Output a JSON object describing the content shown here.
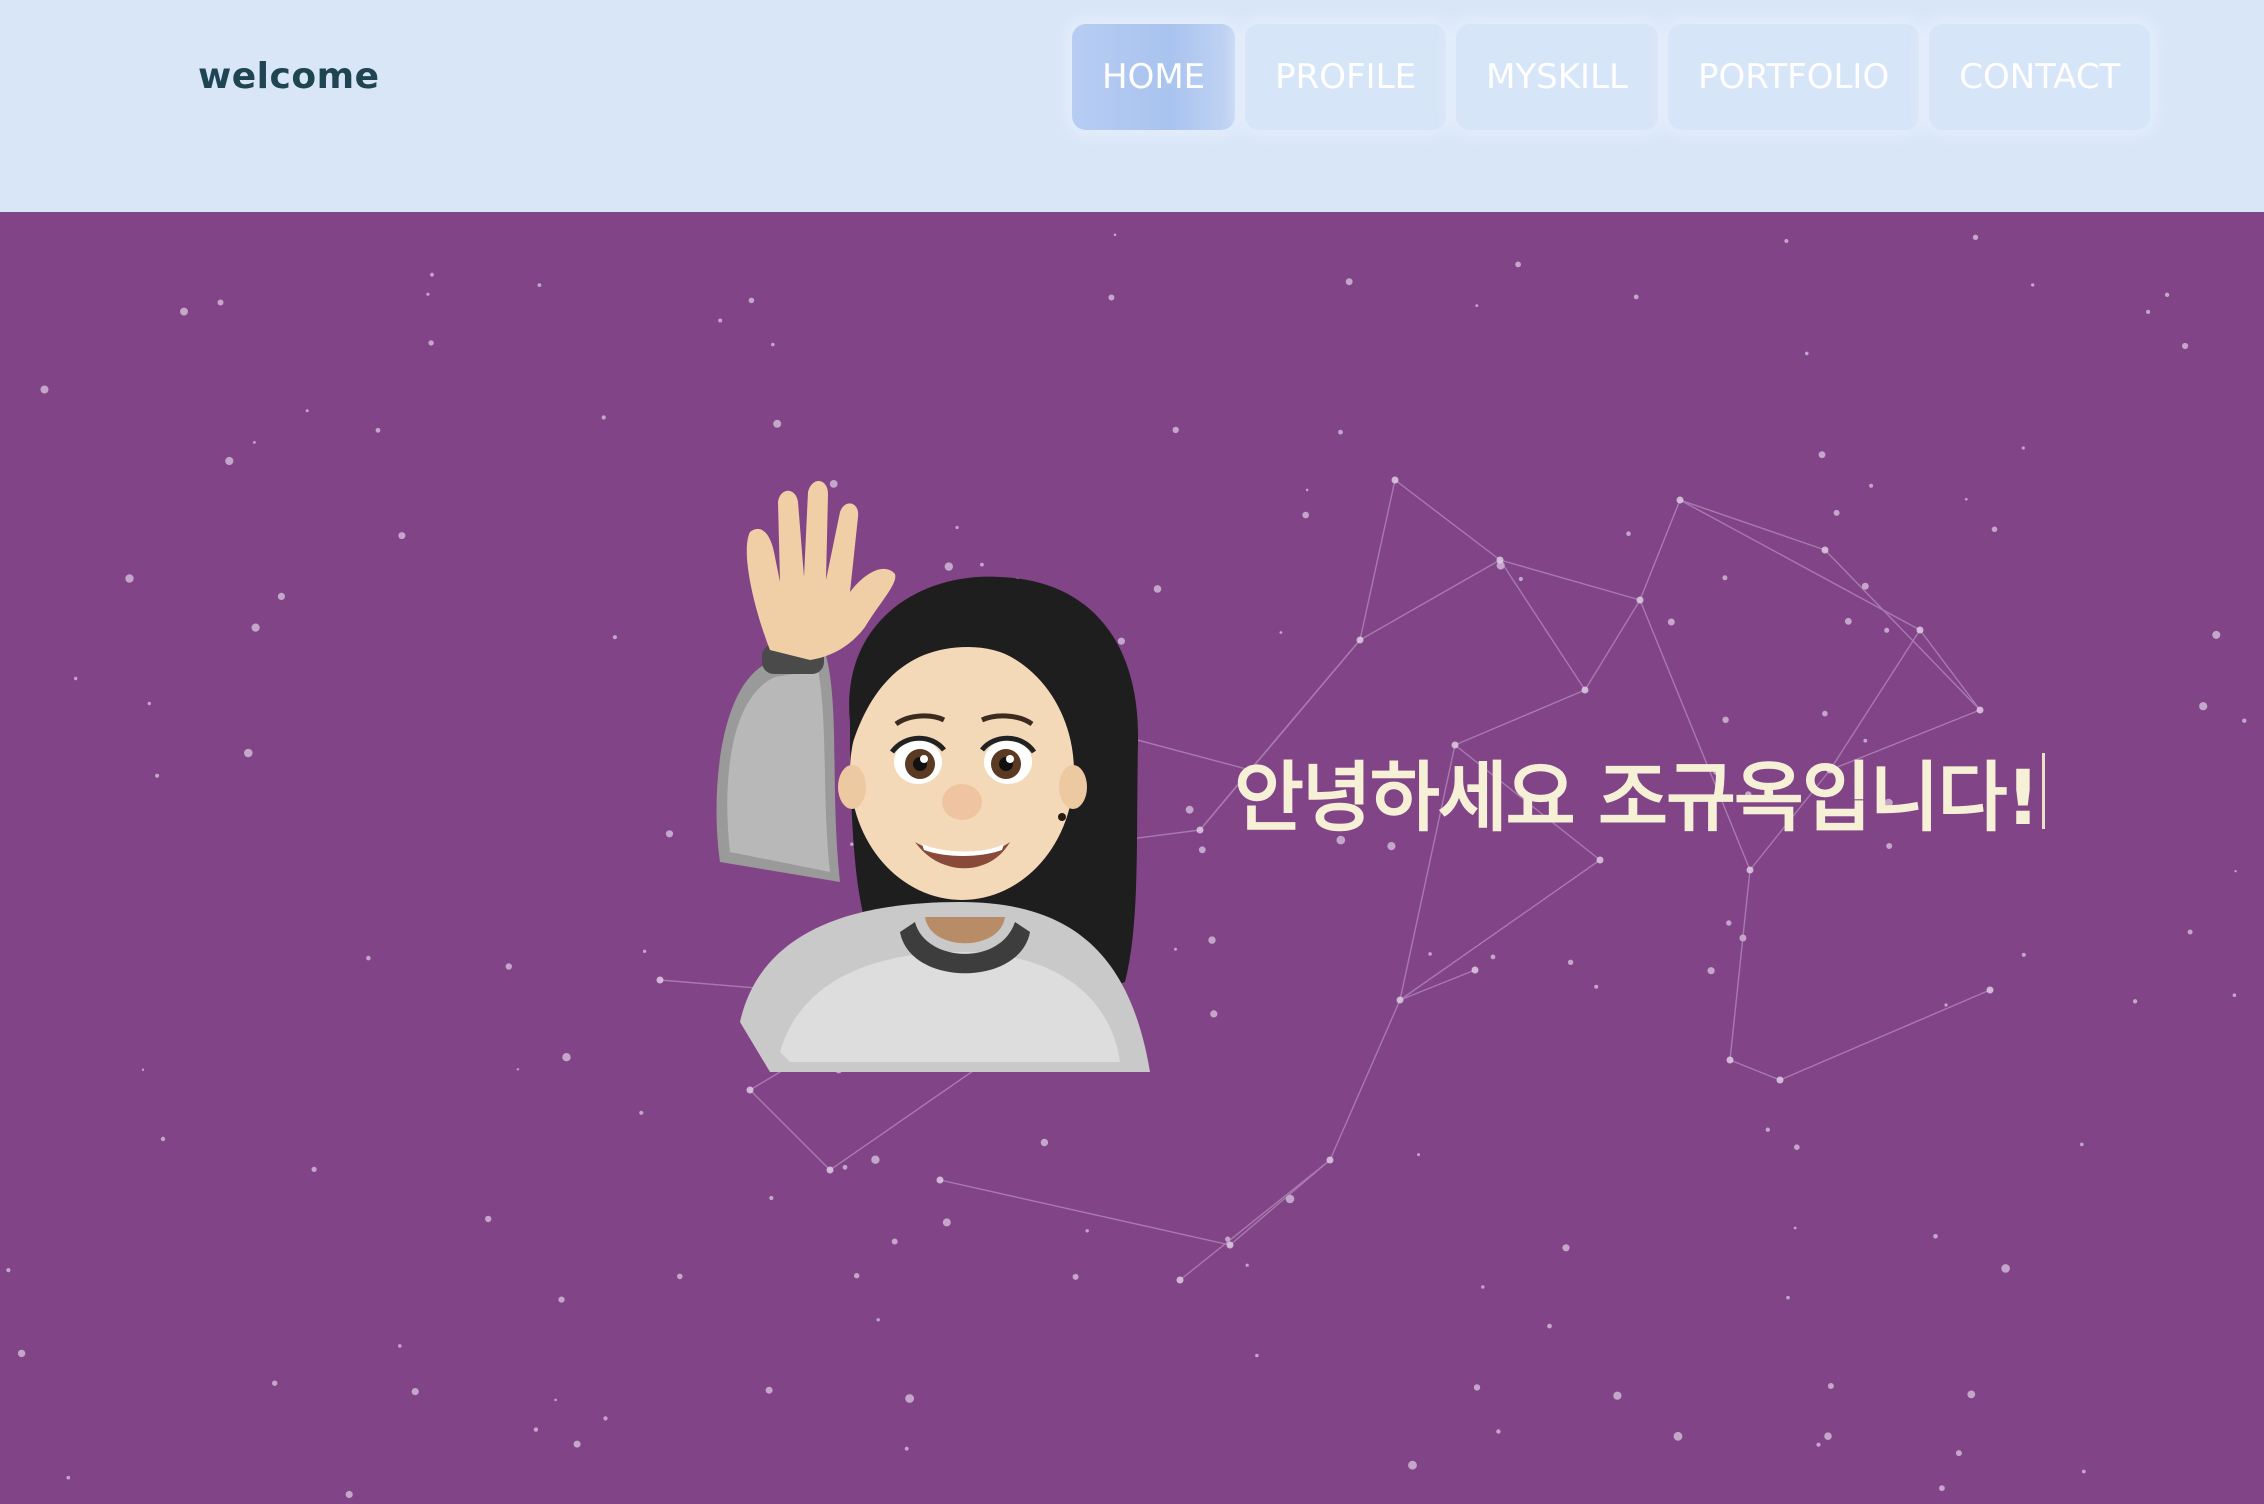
{
  "header": {
    "logo": "welcome",
    "nav": [
      {
        "label": "HOME",
        "active": true
      },
      {
        "label": "PROFILE",
        "active": false
      },
      {
        "label": "MYSKILL",
        "active": false
      },
      {
        "label": "PORTFOLIO",
        "active": false
      },
      {
        "label": "CONTACT",
        "active": false
      }
    ]
  },
  "hero": {
    "headline": "안녕하세요 조규옥입니다!",
    "avatar_icon": "waving-memoji-avatar"
  },
  "colors": {
    "header_bg": "#d8e6f8",
    "hero_bg": "#814487",
    "logo_text": "#1f4452",
    "headline_text": "#f6f0d6",
    "nav_active": "#a9c3f0"
  }
}
